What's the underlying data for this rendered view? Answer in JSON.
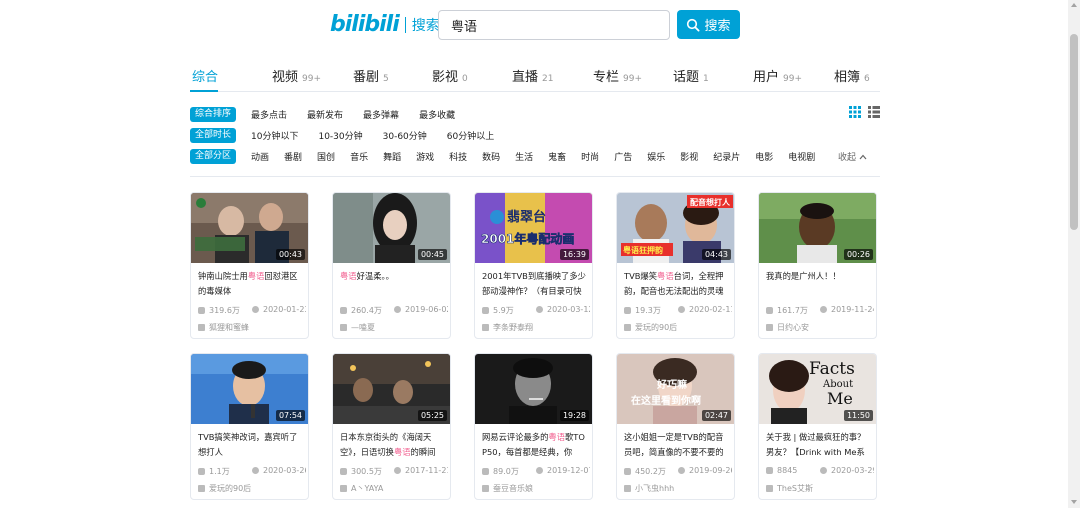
{
  "header": {
    "logo": "bilibili",
    "logo_suffix": "搜索",
    "search_value": "粤语",
    "search_button": "搜索"
  },
  "tabs": [
    {
      "label": "综合",
      "count": "",
      "active": true
    },
    {
      "label": "视频",
      "count": "99+"
    },
    {
      "label": "番剧",
      "count": "5"
    },
    {
      "label": "影视",
      "count": "0"
    },
    {
      "label": "直播",
      "count": "21"
    },
    {
      "label": "专栏",
      "count": "99+"
    },
    {
      "label": "话题",
      "count": "1"
    },
    {
      "label": "用户",
      "count": "99+"
    },
    {
      "label": "相簿",
      "count": "6"
    }
  ],
  "filters": {
    "sort": [
      "综合排序",
      "最多点击",
      "最新发布",
      "最多弹幕",
      "最多收藏"
    ],
    "duration": [
      "全部时长",
      "10分钟以下",
      "10-30分钟",
      "30-60分钟",
      "60分钟以上"
    ],
    "zones": [
      "全部分区",
      "动画",
      "番剧",
      "国创",
      "音乐",
      "舞蹈",
      "游戏",
      "科技",
      "数码",
      "生活",
      "鬼畜",
      "时尚",
      "广告",
      "娱乐",
      "影视",
      "纪录片",
      "电影",
      "电视剧"
    ],
    "collapse": "收起"
  },
  "videos": [
    {
      "title_pre": "钟南山院士用",
      "title_hl": "粤语",
      "title_post": "回怼港区的毒媒体",
      "duration": "00:43",
      "plays": "319.6万",
      "date": "2020-01-23",
      "author": "狐狸和蜜蜂"
    },
    {
      "title_pre": "",
      "title_hl": "粤语",
      "title_post": "好温柔。。",
      "duration": "00:45",
      "plays": "260.4万",
      "date": "2019-06-02",
      "author": "—嗑夏"
    },
    {
      "title_pre": "2001年TVB到底播映了多少部动漫神作？（有目录可快",
      "title_hl": "",
      "title_post": "",
      "duration": "16:39",
      "plays": "5.9万",
      "date": "2020-03-12",
      "author": "李条野泰翔"
    },
    {
      "title_pre": "TVB爆笑",
      "title_hl": "粤语",
      "title_post": "台词，全程押韵，配音也无法配出的灵魂",
      "duration": "04:43",
      "plays": "19.3万",
      "date": "2020-02-11",
      "author": "爱玩的90后"
    },
    {
      "title_pre": "我真的是广州人！！",
      "title_hl": "",
      "title_post": "",
      "duration": "00:26",
      "plays": "161.7万",
      "date": "2019-11-24",
      "author": "日约心安"
    },
    {
      "title_pre": "TVB搞笑神改词，嘉宾听了想打人",
      "title_hl": "",
      "title_post": "",
      "duration": "07:54",
      "plays": "1.1万",
      "date": "2020-03-26",
      "author": "爱玩的90后"
    },
    {
      "title_pre": "日本东京街头的《海阔天空》，日语切换",
      "title_hl": "粤语",
      "title_post": "的瞬间",
      "duration": "05:25",
      "plays": "300.5万",
      "date": "2017-11-21",
      "author": "A丶YAYA"
    },
    {
      "title_pre": "网易云评论最多的",
      "title_hl": "粤语",
      "title_post": "歌TOP50，每首都是经典，你",
      "duration": "19:28",
      "plays": "89.0万",
      "date": "2019-12-07",
      "author": "蚕豆音乐娘"
    },
    {
      "title_pre": "这小姐姐一定是TVB的配音员吧，简直像的不要不要的",
      "title_hl": "",
      "title_post": "",
      "duration": "02:47",
      "plays": "450.2万",
      "date": "2019-09-26",
      "author": "小飞虫hhh"
    },
    {
      "title_pre": "关于我 | 做过最疯狂的事？男友？【Drink with Me系",
      "title_hl": "",
      "title_post": "",
      "duration": "11:50",
      "plays": "8845",
      "date": "2020-03-29",
      "author": "TheS艾斯"
    }
  ],
  "thumb_text": {
    "v3_channel": "翡翠台",
    "v3_caption": "2001年粤配动画",
    "v4_badge": "配音想打人",
    "v4_caption": "粤语狂押韵",
    "v9_caption_1": "好巧嘛",
    "v9_caption_2": "在这里看到你啊",
    "v10_caption_1": "Facts",
    "v10_caption_2": "About",
    "v10_caption_3": "Me"
  },
  "colors": {
    "accent": "#00a1d6",
    "highlight": "#f25d8e"
  }
}
